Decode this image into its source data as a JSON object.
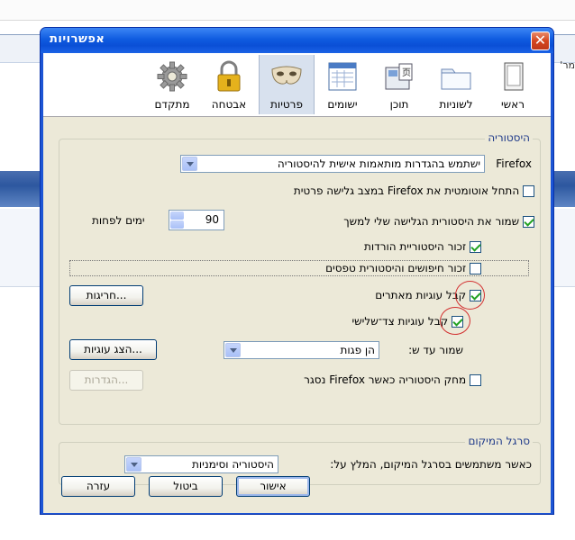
{
  "background": {
    "right_fragment": "'מר"
  },
  "window": {
    "title": "אפשרויות",
    "close_glyph": "✕"
  },
  "toolbar": {
    "items": [
      {
        "label": "ראשי",
        "icon": "window-icon"
      },
      {
        "label": "לשוניות",
        "icon": "folder-tabs-icon"
      },
      {
        "label": "תוכן",
        "icon": "content-icon"
      },
      {
        "label": "ישומים",
        "icon": "applications-icon"
      },
      {
        "label": "פרטיות",
        "icon": "mask-icon",
        "selected": true
      },
      {
        "label": "אבטחה",
        "icon": "lock-icon"
      },
      {
        "label": "מתקדם",
        "icon": "gear-icon"
      }
    ]
  },
  "history": {
    "title": "היסטוריה",
    "firefox_label": "Firefox",
    "mode_select": "ישתמש בהגדרות מותאמות אישית להיסטוריה",
    "private_browsing": {
      "label": "התחל אוטומטית את Firefox במצב גלישה פרטית",
      "checked": false
    },
    "keep_history": {
      "label": "שמור את היסטורית הגלישה שלי למשך",
      "checked": true,
      "days": "90",
      "days_suffix": "ימים לפחות"
    },
    "downloads": {
      "label": "זכור היסטוריית הורדות",
      "checked": true
    },
    "search_forms": {
      "label": "זכור חיפושים והיסטורית טפסים",
      "checked": false
    },
    "accept_cookies": {
      "label": "קבל עוגיות מאתרים",
      "checked": true
    },
    "exceptions_button": "חריגות...",
    "third_party": {
      "label": "קבל עוגיות צד־שלישי",
      "checked": true
    },
    "keep_until_label": "שמור עד ש:",
    "keep_until_value": "הן פגות",
    "show_cookies_button": "הצג עוגיות...",
    "clear_on_close": {
      "label": "מחק היסטוריה כאשר Firefox נסגר",
      "checked": false
    },
    "settings_button": "הגדרות..."
  },
  "location_bar": {
    "title": "סרגל המיקום",
    "label": "כאשר משתמשים בסרגל המיקום, המלץ על:",
    "select": "היסטוריה וסימניות"
  },
  "buttons": {
    "ok": "אישור",
    "cancel": "ביטול",
    "help": "עזרה"
  }
}
